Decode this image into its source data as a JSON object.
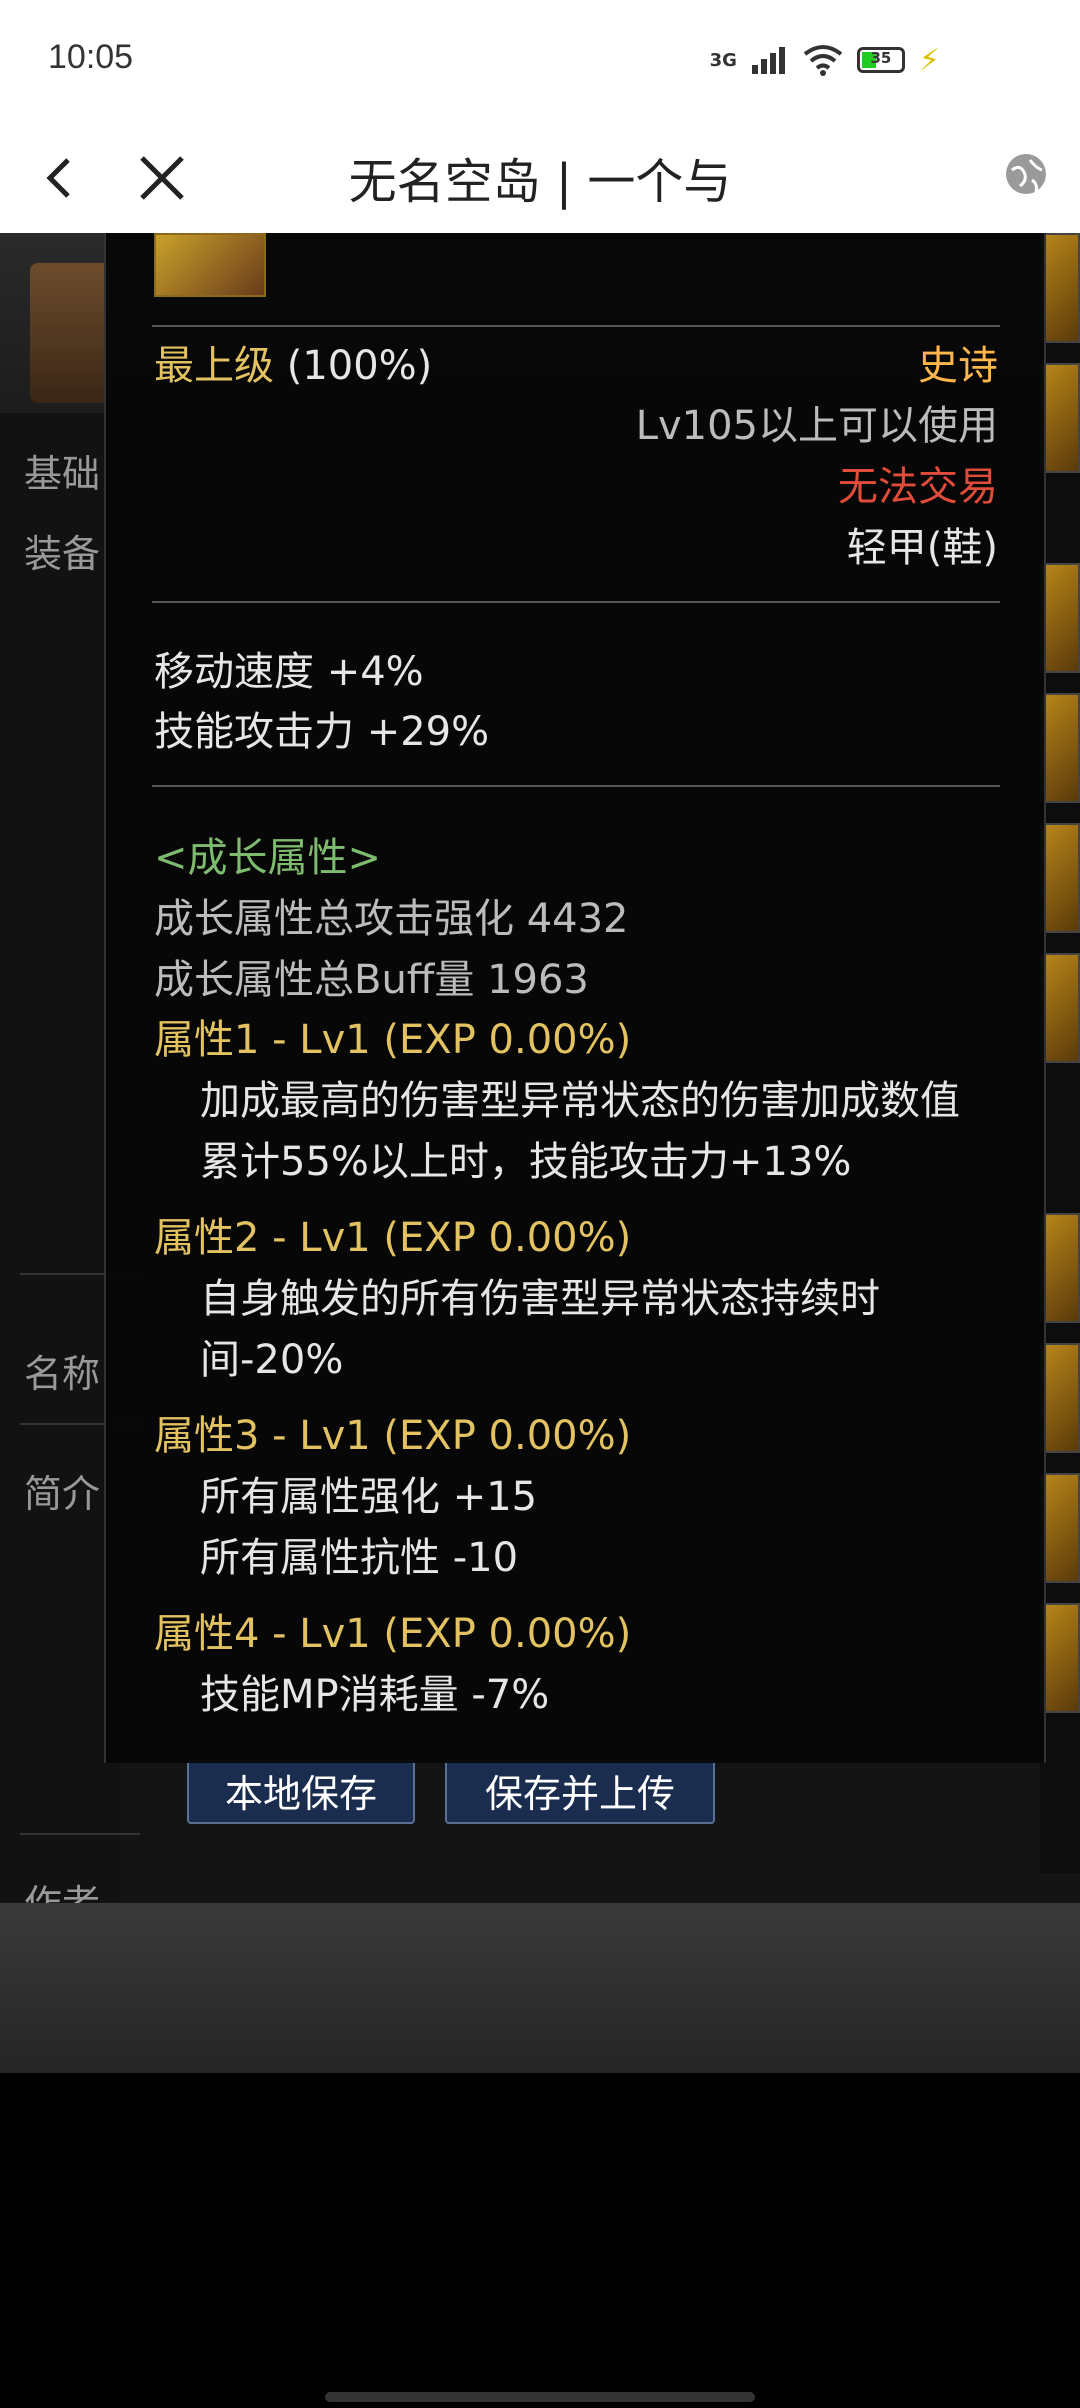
{
  "status_bar": {
    "time": "10:05",
    "network": "3G",
    "battery": "35"
  },
  "title_bar": {
    "title": "无名空岛 | 一个与"
  },
  "background": {
    "labels": [
      "基础",
      "装备",
      "名称",
      "简介",
      "作者"
    ]
  },
  "buttons": {
    "local_save": "本地保存",
    "save_upload": "保存并上传"
  },
  "tooltip": {
    "grade": "最上级",
    "grade_pct": "(100%)",
    "rarity": "史诗",
    "level_req": "Lv105以上可以使用",
    "trade": "无法交易",
    "slot_type": "轻甲(鞋)",
    "stats": [
      "移动速度   +4%",
      "技能攻击力   +29%"
    ],
    "growth_header": "<成长属性>",
    "growth_total_attack": "成长属性总攻击强化 4432",
    "growth_total_buff": "成长属性总Buff量 1963",
    "attributes": [
      {
        "title": "属性1 - Lv1 (EXP 0.00%)",
        "lines": [
          "加成最高的伤害型异常状态的伤害加成数值",
          "累计55%以上时，技能攻击力+13%"
        ]
      },
      {
        "title": "属性2 - Lv1 (EXP 0.00%)",
        "lines": [
          "自身触发的所有伤害型异常状态持续时",
          "间-20%"
        ]
      },
      {
        "title": "属性3 - Lv1 (EXP 0.00%)",
        "lines": [
          "所有属性强化 +15",
          "所有属性抗性 -10"
        ]
      },
      {
        "title": "属性4 - Lv1 (EXP 0.00%)",
        "lines": [
          "技能MP消耗量 -7%"
        ]
      }
    ]
  },
  "colors": {
    "gold": "#e3c261",
    "epic": "#ffb64a",
    "untradable": "#e04b3a",
    "growth": "#7dbb6e"
  }
}
